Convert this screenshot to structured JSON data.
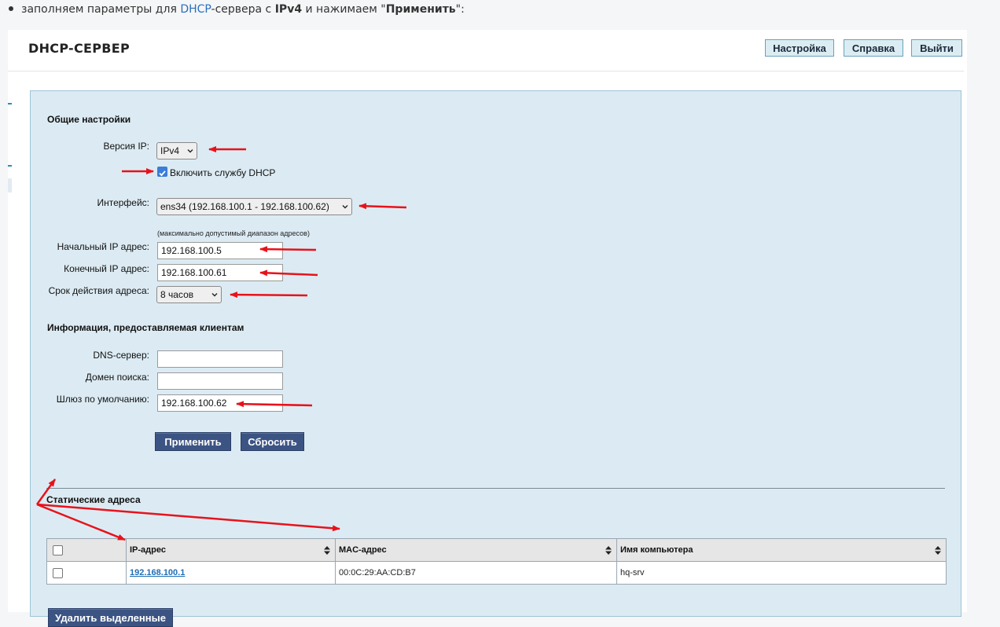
{
  "intro": {
    "text_before": "заполняем параметры для ",
    "link": "DHCP",
    "text_mid": "-сервера с ",
    "bold1": "IPv4",
    "text_mid2": " и нажимаем \"",
    "bold2": "Применить",
    "text_after": "\":"
  },
  "header": {
    "title": "DHCP-СЕРВЕР",
    "buttons": {
      "settings": "Настройка",
      "help": "Справка",
      "exit": "Выйти"
    }
  },
  "general": {
    "title": "Общие настройки",
    "ip_version_label": "Версия IP:",
    "ip_version_value": "IPv4",
    "enable_dhcp_label": "Включить службу DHCP",
    "enable_dhcp_checked": true,
    "interface_label": "Интерфейс:",
    "interface_value": "ens34 (192.168.100.1 - 192.168.100.62)",
    "range_note": "(максимально допустимый диапазон адресов)",
    "start_ip_label": "Начальный IP адрес:",
    "start_ip_value": "192.168.100.5",
    "end_ip_label": "Конечный IP адрес:",
    "end_ip_value": "192.168.100.61",
    "lease_label": "Срок действия адреса:",
    "lease_value": "8 часов"
  },
  "client_info": {
    "title": "Информация, предоставляемая клиентам",
    "dns_label": "DNS-сервер:",
    "dns_value": "",
    "search_domain_label": "Домен поиска:",
    "search_domain_value": "",
    "gateway_label": "Шлюз по умолчанию:",
    "gateway_value": "192.168.100.62"
  },
  "actions": {
    "apply": "Применить",
    "reset": "Сбросить"
  },
  "static": {
    "title": "Статические адреса",
    "columns": [
      "IP-адрес",
      "MAC-адрес",
      "Имя компьютера"
    ],
    "rows": [
      {
        "ip": "192.168.100.1",
        "mac": "00:0C:29:AA:CD:B7",
        "hostname": "hq-srv"
      }
    ],
    "delete_label": "Удалить выделенные"
  },
  "colors": {
    "annotation_arrow": "#e8121b",
    "form_bg": "#dcebf3",
    "dark_button": "#3c5483"
  }
}
